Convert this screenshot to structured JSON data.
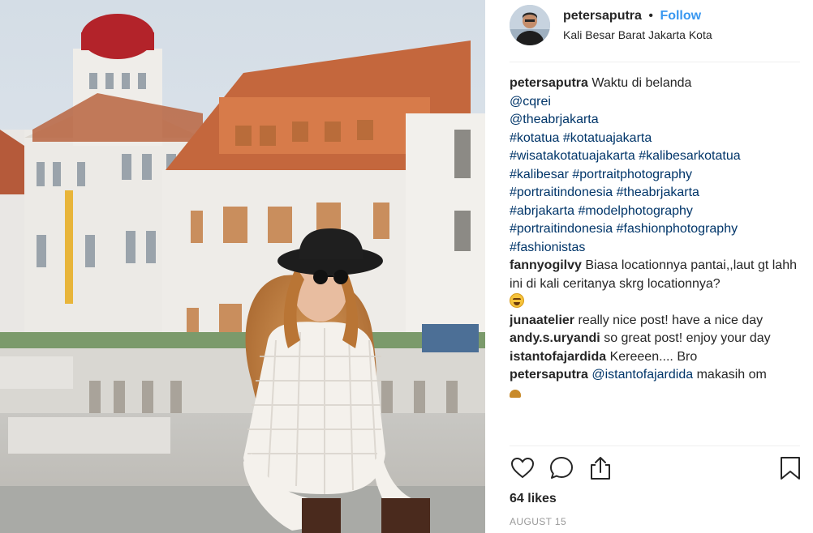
{
  "post": {
    "username": "petersaputra",
    "separator": "•",
    "follow_label": "Follow",
    "location": "Kali Besar Barat Jakarta Kota"
  },
  "caption": {
    "username": "petersaputra",
    "text": "Waktu di belanda",
    "mentions": [
      "@cqrei",
      "@theabrjakarta"
    ],
    "hashtag_lines": [
      "#kotatua #kotatuajakarta",
      "#wisatakotatuajakarta #kalibesarkotatua",
      "#kalibesar #portraitphotography",
      "#portraitindonesia #theabrjakarta",
      "#abrjakarta #modelphotography",
      "#portraitindonesia #fashionphotography",
      "#fashionistas"
    ]
  },
  "comments": [
    {
      "username": "fannyogilvy",
      "text": "Biasa locationnya pantai,,laut gt lahh ini di kali ceritanya skrg locationnya?",
      "emoji": "grinning-squinting-face"
    },
    {
      "username": "junaatelier",
      "text": "really nice post! have a nice day"
    },
    {
      "username": "andy.s.uryandi",
      "text": "so great post! enjoy your day"
    },
    {
      "username": "istantofajardida",
      "text": "Kereeen.... Bro"
    },
    {
      "username": "petersaputra",
      "mention": "@istantofajardida",
      "text": "makasih om"
    }
  ],
  "actions": {
    "like_icon": "heart-icon",
    "comment_icon": "speech-bubble-icon",
    "share_icon": "share-icon",
    "save_icon": "bookmark-icon"
  },
  "likes_label": "64 likes",
  "date": "AUGUST 15",
  "colors": {
    "follow": "#3897f0",
    "link": "#003569",
    "muted": "#999999",
    "divider": "#efefef"
  }
}
